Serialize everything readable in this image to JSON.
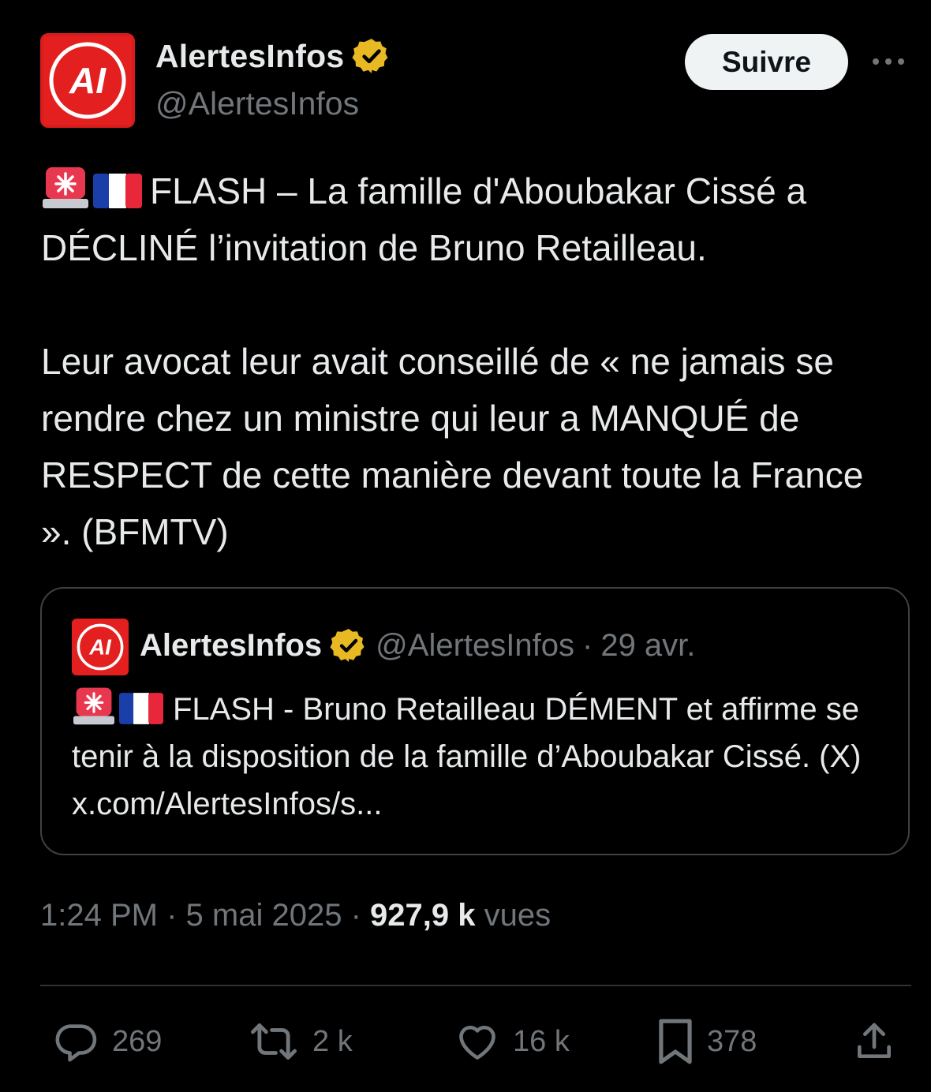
{
  "author": {
    "name": "AlertesInfos",
    "handle": "@AlertesInfos",
    "avatar_text": "AI"
  },
  "follow_label": "Suivre",
  "tweet": {
    "line1": "FLASH – La famille d'Aboubakar Cissé a DÉCLINÉ l’invitation de Bruno Retailleau.",
    "line2": "Leur avocat leur avait conseillé de « ne jamais se rendre chez un ministre qui leur a MANQUÉ de RESPECT de cette manière devant toute la France ». (BFMTV)"
  },
  "quoted": {
    "name": "AlertesInfos",
    "handle": "@AlertesInfos",
    "separator": "·",
    "date": "29 avr.",
    "text": "FLASH - Bruno Retailleau DÉMENT et affirme se tenir à la disposition de la famille d’Aboubakar Cissé. (X) x.com/AlertesInfos/s..."
  },
  "meta": {
    "time": "1:24 PM",
    "separator": "·",
    "date": "5 mai 2025",
    "views_count": "927,9 k",
    "views_label": "vues"
  },
  "actions": {
    "replies": "269",
    "retweets": "2 k",
    "likes": "16 k",
    "bookmarks": "378"
  },
  "icons": {
    "verified": "verified-badge-icon",
    "more": "more-dots-icon",
    "siren": "siren-emoji-icon",
    "flag": "france-flag-emoji-icon",
    "reply": "reply-icon",
    "retweet": "retweet-icon",
    "like": "heart-icon",
    "bookmark": "bookmark-icon",
    "share": "share-icon"
  },
  "colors": {
    "background": "#000000",
    "text": "#e7e9ea",
    "secondary": "#71767b",
    "brand_red": "#e01b1b",
    "verified_gold": "#e8b923",
    "border": "#3e4144"
  }
}
